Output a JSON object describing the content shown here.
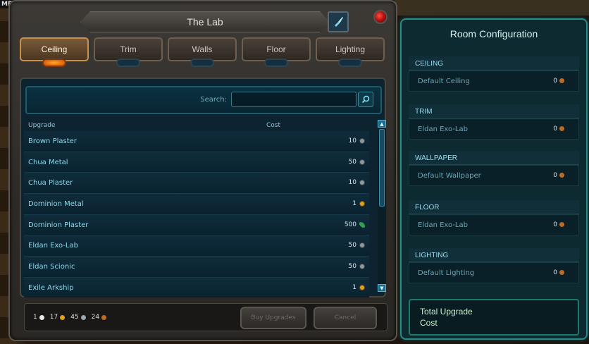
{
  "hud": {
    "corner_text": "ME"
  },
  "window": {
    "title": "The Lab"
  },
  "tabs": [
    {
      "label": "Ceiling",
      "active": true
    },
    {
      "label": "Trim",
      "active": false
    },
    {
      "label": "Walls",
      "active": false
    },
    {
      "label": "Floor",
      "active": false
    },
    {
      "label": "Lighting",
      "active": false
    }
  ],
  "search": {
    "label": "Search:",
    "value": ""
  },
  "table": {
    "headers": {
      "upgrade": "Upgrade",
      "cost": "Cost"
    },
    "rows": [
      {
        "name": "Brown Plaster",
        "cost": "10",
        "currency": "silver"
      },
      {
        "name": "Chua Metal",
        "cost": "50",
        "currency": "silver"
      },
      {
        "name": "Chua Plaster",
        "cost": "10",
        "currency": "silver"
      },
      {
        "name": "Dominion Metal",
        "cost": "1",
        "currency": "gold"
      },
      {
        "name": "Dominion Plaster",
        "cost": "500",
        "currency": "leaf"
      },
      {
        "name": "Eldan Exo-Lab",
        "cost": "50",
        "currency": "silver"
      },
      {
        "name": "Eldan Scionic",
        "cost": "50",
        "currency": "silver"
      },
      {
        "name": "Exile Arkship",
        "cost": "1",
        "currency": "gold"
      }
    ]
  },
  "wallet": {
    "platinum": "1",
    "gold": "17",
    "silver": "45",
    "copper": "24"
  },
  "buttons": {
    "buy": "Buy Upgrades",
    "cancel": "Cancel"
  },
  "config": {
    "title": "Room Configuration",
    "sections": [
      {
        "heading": "CEILING",
        "value": "Default Ceiling",
        "cost": "0"
      },
      {
        "heading": "TRIM",
        "value": "Eldan Exo-Lab",
        "cost": "0"
      },
      {
        "heading": "WALLPAPER",
        "value": "Default Wallpaper",
        "cost": "0"
      },
      {
        "heading": "FLOOR",
        "value": "Eldan Exo-Lab",
        "cost": "0"
      },
      {
        "heading": "LIGHTING",
        "value": "Default Lighting",
        "cost": "0"
      }
    ],
    "total_line1": "Total Upgrade",
    "total_line2": "Cost"
  },
  "colors": {
    "accent": "#2a8a8a",
    "tab_active": "#c8904a",
    "text_cyan": "#8fd8ea"
  }
}
